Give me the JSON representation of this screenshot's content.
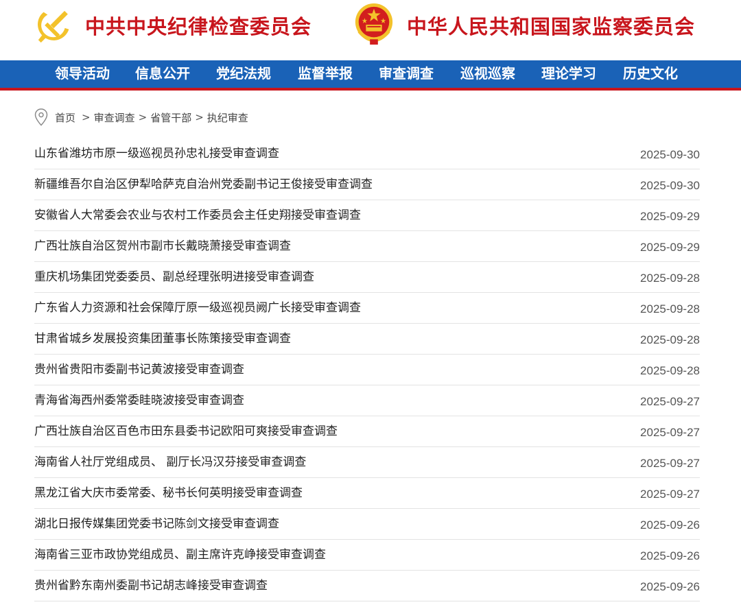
{
  "header": {
    "left_title": "中共中央纪律检查委员会",
    "right_title": "中华人民共和国国家监察委员会"
  },
  "colors": {
    "brand_red": "#c8161d",
    "nav_blue": "#1a62b7",
    "emblem_gold": "#f3c22b"
  },
  "nav": {
    "items": [
      {
        "label": "领导活动"
      },
      {
        "label": "信息公开"
      },
      {
        "label": "党纪法规"
      },
      {
        "label": "监督举报"
      },
      {
        "label": "审查调查"
      },
      {
        "label": "巡视巡察"
      },
      {
        "label": "理论学习"
      },
      {
        "label": "历史文化"
      }
    ]
  },
  "breadcrumb": {
    "icon": "location-pin-icon",
    "items": [
      {
        "label": "首页"
      },
      {
        "label": "审查调查"
      },
      {
        "label": "省管干部"
      },
      {
        "label": "执纪审查"
      }
    ],
    "separator": ">"
  },
  "articles": [
    {
      "title": "山东省潍坊市原一级巡视员孙忠礼接受审查调查",
      "date": "2025-09-30"
    },
    {
      "title": "新疆维吾尔自治区伊犁哈萨克自治州党委副书记王俊接受审查调查",
      "date": "2025-09-30"
    },
    {
      "title": "安徽省人大常委会农业与农村工作委员会主任史翔接受审查调查",
      "date": "2025-09-29"
    },
    {
      "title": "广西壮族自治区贺州市副市长戴晓萧接受审查调查",
      "date": "2025-09-29"
    },
    {
      "title": "重庆机场集团党委委员、副总经理张明进接受审查调查",
      "date": "2025-09-28"
    },
    {
      "title": "广东省人力资源和社会保障厅原一级巡视员阙广长接受审查调查",
      "date": "2025-09-28"
    },
    {
      "title": "甘肃省城乡发展投资集团董事长陈策接受审查调查",
      "date": "2025-09-28"
    },
    {
      "title": "贵州省贵阳市委副书记黄波接受审查调查",
      "date": "2025-09-28"
    },
    {
      "title": "青海省海西州委常委眭晓波接受审查调查",
      "date": "2025-09-27"
    },
    {
      "title": "广西壮族自治区百色市田东县委书记欧阳可爽接受审查调查",
      "date": "2025-09-27"
    },
    {
      "title": "海南省人社厅党组成员、 副厅长冯汉芬接受审查调查",
      "date": "2025-09-27"
    },
    {
      "title": "黑龙江省大庆市委常委、秘书长何英明接受审查调查",
      "date": "2025-09-27"
    },
    {
      "title": "湖北日报传媒集团党委书记陈剑文接受审查调查",
      "date": "2025-09-26"
    },
    {
      "title": "海南省三亚市政协党组成员、副主席许克峥接受审查调查",
      "date": "2025-09-26"
    },
    {
      "title": "贵州省黔东南州委副书记胡志峰接受审查调查",
      "date": "2025-09-26"
    }
  ]
}
